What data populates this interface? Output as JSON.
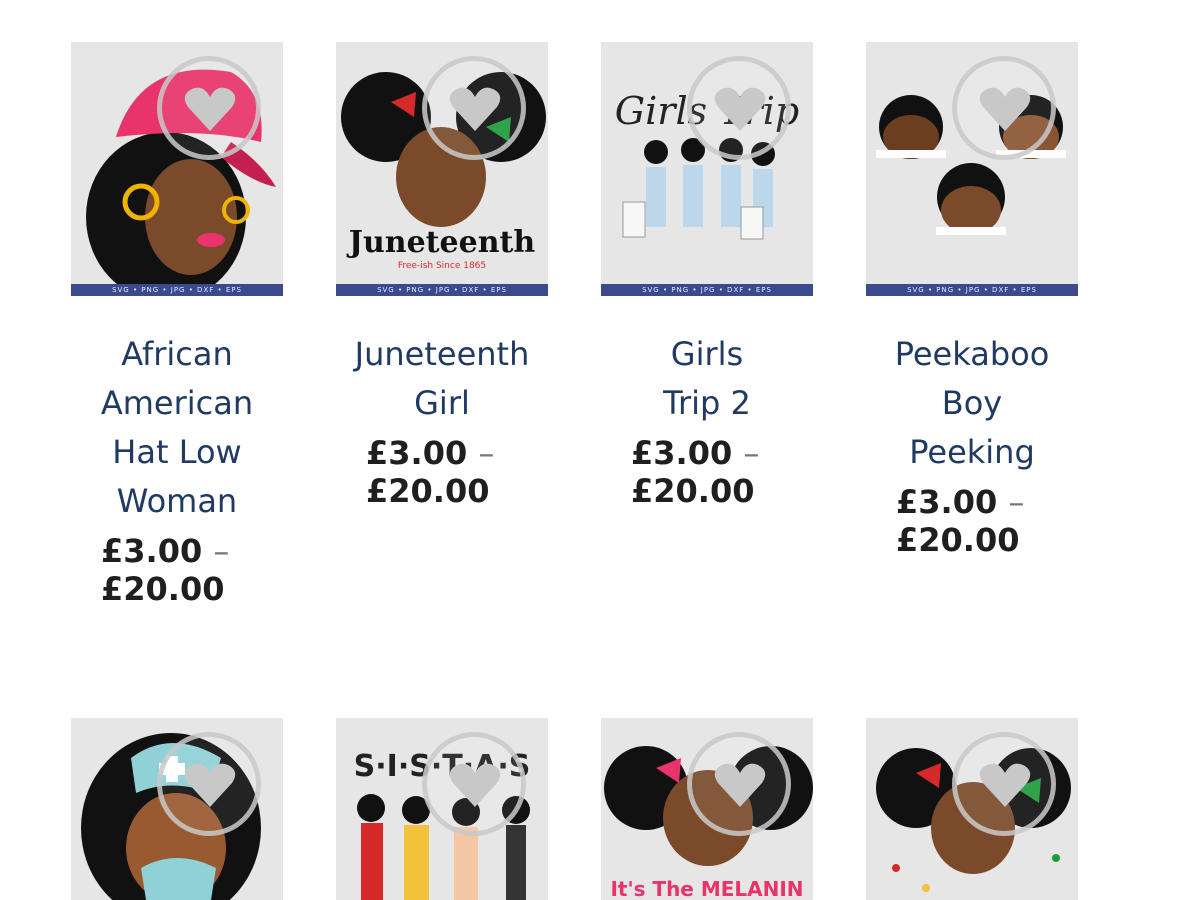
{
  "products": [
    {
      "title_lines": [
        "African",
        "American",
        "Hat Low",
        "Woman"
      ],
      "price_min": "£3.00",
      "price_sep": "–",
      "price_max": "£20.00",
      "strip": "SVG • PNG • JPG • DXF • EPS"
    },
    {
      "title_lines": [
        "Juneteenth",
        "Girl"
      ],
      "price_min": "£3.00",
      "price_sep": "–",
      "price_max": "£20.00",
      "strip": "SVG • PNG • JPG • DXF • EPS",
      "art_text": "Juneteenth",
      "art_sub": "Free-ish Since 1865"
    },
    {
      "title_lines": [
        "Girls",
        "Trip 2"
      ],
      "price_min": "£3.00",
      "price_sep": "–",
      "price_max": "£20.00",
      "strip": "SVG • PNG • JPG • DXF • EPS",
      "art_text": "Girls Trip"
    },
    {
      "title_lines": [
        "Peekaboo",
        "Boy",
        "Peeking"
      ],
      "price_min": "£3.00",
      "price_sep": "–",
      "price_max": "£20.00",
      "strip": "SVG • PNG • JPG • DXF • EPS"
    }
  ],
  "row2": [
    {
      "art_text": ""
    },
    {
      "art_text": "S·I·S·T·A·S"
    },
    {
      "art_text": "It's The MELANIN"
    },
    {
      "art_text": ""
    }
  ],
  "colors": {
    "title": "#203a63",
    "price": "#1f1f1f",
    "strip": "#3b4a8c",
    "heart": "#c8c8c8"
  }
}
